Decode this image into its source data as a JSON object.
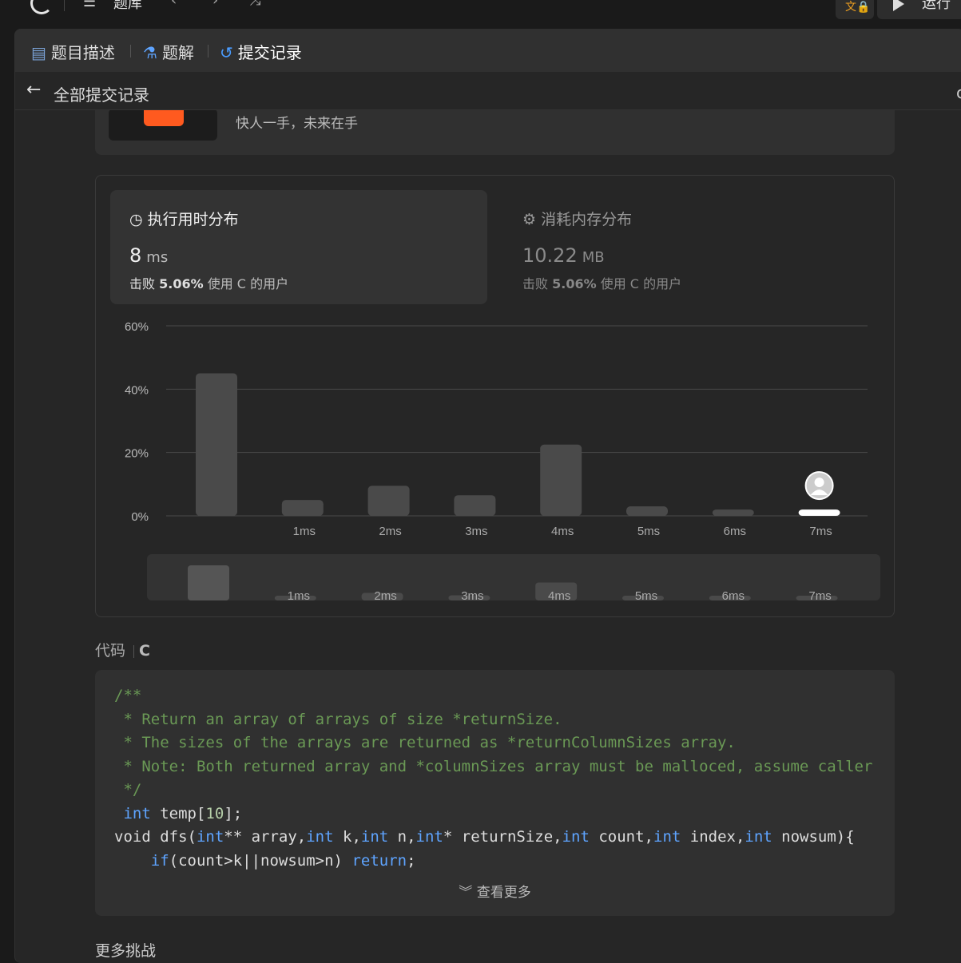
{
  "topbar": {
    "problem_bank": "题库",
    "run_button": "运行",
    "icons": [
      "leetcode-logo-icon",
      "list-icon",
      "chevron-left-icon",
      "chevron-right-icon",
      "shuffle-icon",
      "translate-lock-icon",
      "play-icon"
    ]
  },
  "tabs": {
    "description": "题目描述",
    "solutions": "题解",
    "submissions": "提交记录"
  },
  "subbar": {
    "title": "全部提交记录"
  },
  "promo": {
    "slogan": "快人一手，未来在手"
  },
  "runtime_card": {
    "title": "执行用时分布",
    "value": "8",
    "unit": "ms",
    "beat_prefix": "击败",
    "beat_percent": "5.06%",
    "beat_suffix": "使用 C 的用户"
  },
  "memory_card": {
    "title": "消耗内存分布",
    "value": "10.22",
    "unit": "MB",
    "beat_prefix": "击败",
    "beat_percent": "5.06%",
    "beat_suffix": "使用 C 的用户"
  },
  "chart_data": {
    "type": "bar",
    "categories": [
      "",
      "1ms",
      "2ms",
      "3ms",
      "4ms",
      "5ms",
      "6ms",
      "7ms"
    ],
    "values": [
      45,
      5,
      9.5,
      6.5,
      22.5,
      3,
      2,
      2
    ],
    "y_ticks": [
      "0%",
      "20%",
      "40%",
      "60%"
    ],
    "ylim": [
      0,
      60
    ],
    "grid": true,
    "highlight_index": 7
  },
  "code": {
    "header": "代码",
    "language": "C",
    "lines": [
      "/**",
      " * Return an array of arrays of size *returnSize.",
      " * The sizes of the arrays are returned as *returnColumnSizes array.",
      " * Note: Both returned array and *columnSizes array must be malloced, assume caller calls free().",
      " */",
      " int temp[10];",
      "void dfs(int** array,int k,int n,int* returnSize,int count,int index,int nowsum){",
      "    if(count>k||nowsum>n) return;"
    ],
    "show_more": "查看更多"
  },
  "more_challenges": "更多挑战"
}
